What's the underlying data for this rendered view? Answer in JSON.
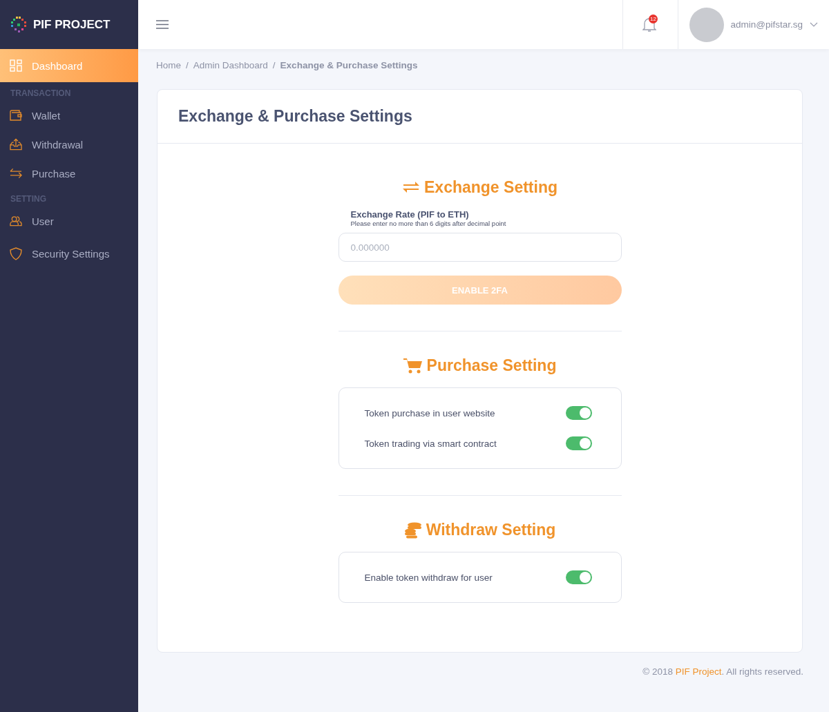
{
  "brand": {
    "name": "PIF PROJECT"
  },
  "sidebar": {
    "items": [
      {
        "kind": "item",
        "label": "Dashboard",
        "selected": true
      },
      {
        "kind": "heading",
        "label": "TRANSACTION"
      },
      {
        "kind": "item",
        "label": "Wallet",
        "selected": false
      },
      {
        "kind": "item",
        "label": "Withdrawal",
        "selected": false
      },
      {
        "kind": "item",
        "label": "Purchase",
        "selected": false
      },
      {
        "kind": "heading",
        "label": "SETTING"
      },
      {
        "kind": "item",
        "label": "User",
        "selected": false
      },
      {
        "kind": "item",
        "label": "Security Settings",
        "selected": false
      }
    ]
  },
  "topbar": {
    "notification_count": "12",
    "user": "admin@pifstar.sg"
  },
  "breadcrumb": {
    "separator": "/",
    "items": [
      "Home",
      "Admin Dashboard",
      "Exchange & Purchase Settings"
    ]
  },
  "card": {
    "title": "Exchange & Purchase Settings",
    "sections": [
      {
        "kind": "form",
        "title": "Exchange Setting",
        "label": "Exchange Rate (PIF to ETH)",
        "hint": "Please enter no more than 6 digits after decimal point",
        "placeholder": "0.000000",
        "button": {
          "label": "ENABLE 2FA",
          "disabled": true
        }
      },
      {
        "kind": "toggles",
        "title": "Purchase Setting",
        "toggles": [
          {
            "label": "Token purchase in user website",
            "on": true
          },
          {
            "label": "Token trading via smart contract",
            "on": true
          }
        ]
      },
      {
        "kind": "toggles",
        "title": "Withdraw Setting",
        "toggles": [
          {
            "label": "Enable token withdraw for user",
            "on": true
          }
        ]
      }
    ]
  },
  "footer": {
    "prefix": "© 2018 ",
    "link": "PIF Project",
    "suffix": ". All rights reserved."
  }
}
